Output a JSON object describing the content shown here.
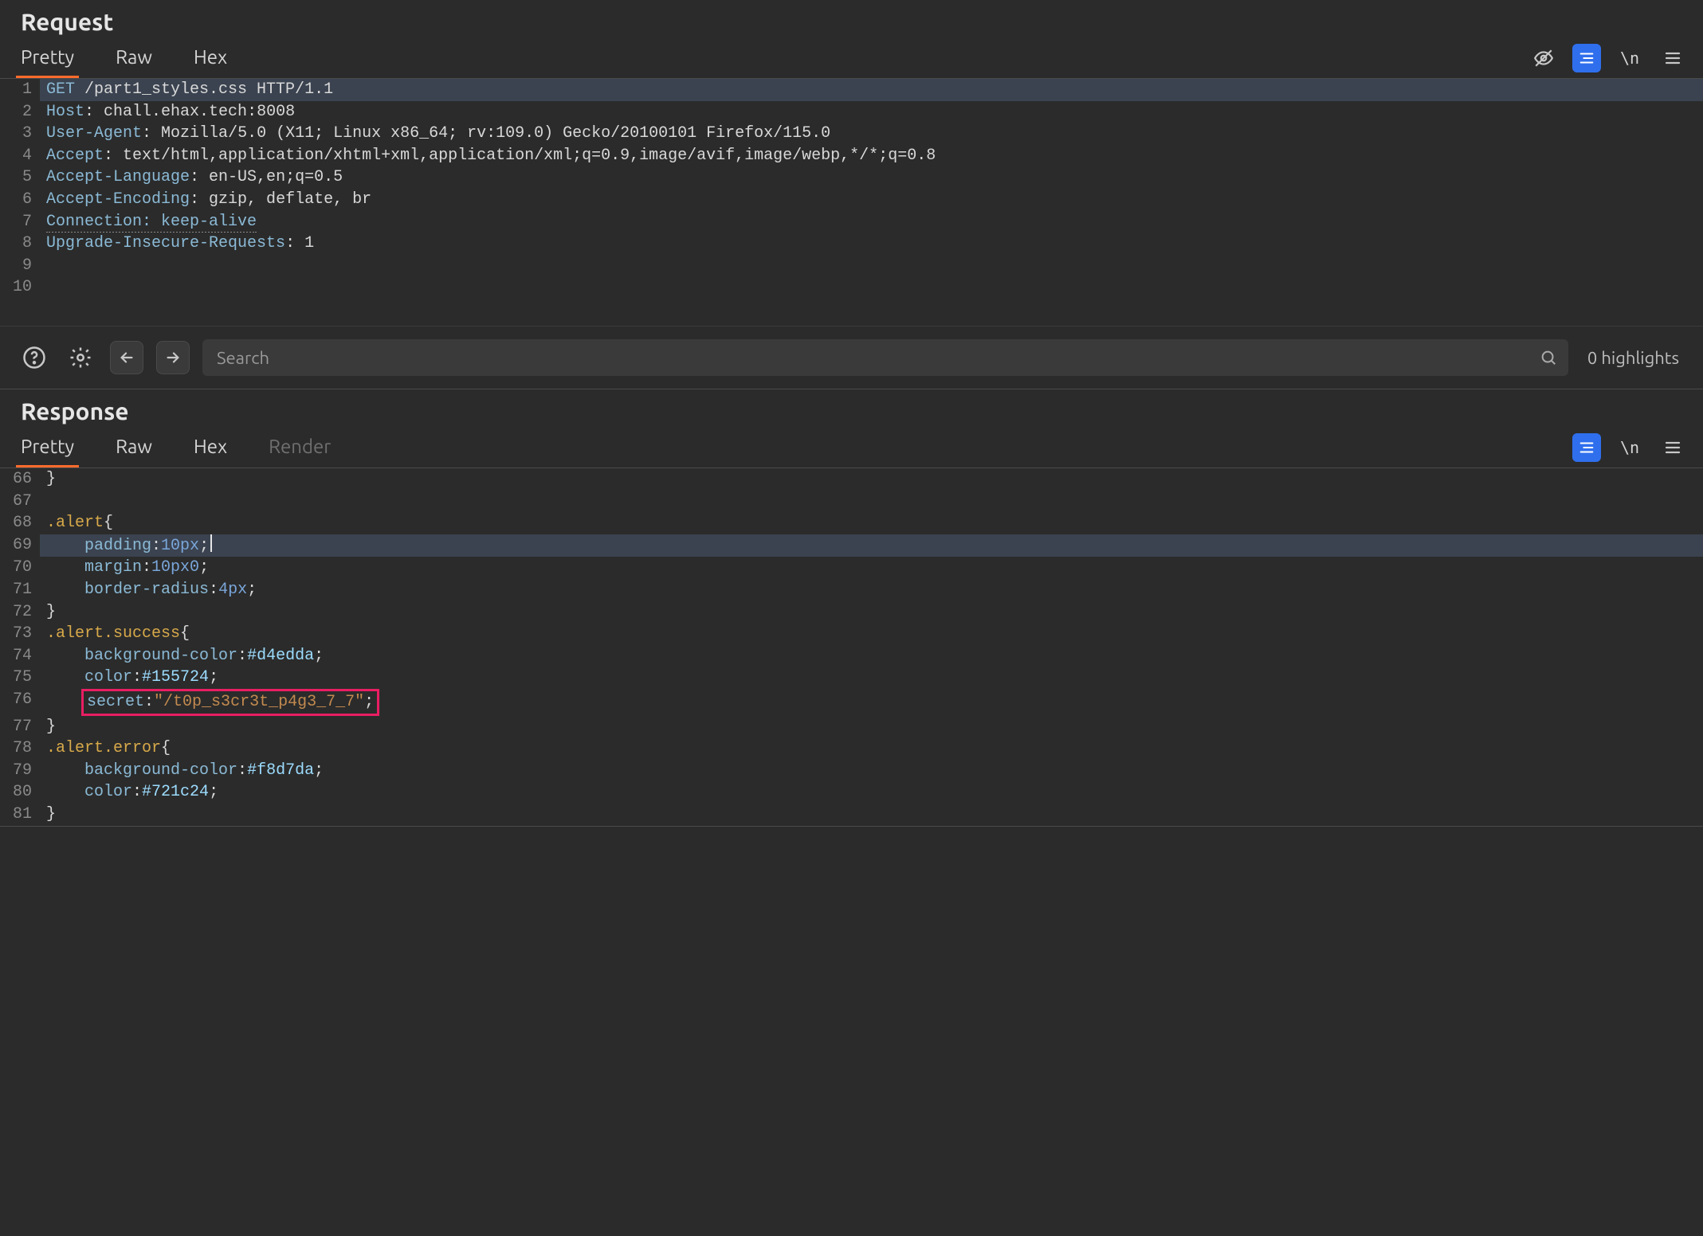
{
  "request": {
    "title": "Request",
    "tabs": {
      "pretty": "Pretty",
      "raw": "Raw",
      "hex": "Hex",
      "active": "pretty"
    },
    "lines": [
      {
        "n": 1,
        "type": "req-line",
        "method": "GET",
        "path": "/part1_styles.css",
        "proto": "HTTP/1.1",
        "selected": true
      },
      {
        "n": 2,
        "type": "hdr",
        "name": "Host",
        "value": "chall.ehax.tech:8008"
      },
      {
        "n": 3,
        "type": "hdr",
        "name": "User-Agent",
        "value": "Mozilla/5.0 (X11; Linux x86_64; rv:109.0) Gecko/20100101 Firefox/115.0"
      },
      {
        "n": 4,
        "type": "hdr",
        "name": "Accept",
        "value": "text/html,application/xhtml+xml,application/xml;q=0.9,image/avif,image/webp,*/*;q=0.8"
      },
      {
        "n": 5,
        "type": "hdr",
        "name": "Accept-Language",
        "value": "en-US,en;q=0.5"
      },
      {
        "n": 6,
        "type": "hdr",
        "name": "Accept-Encoding",
        "value": "gzip, deflate, br"
      },
      {
        "n": 7,
        "type": "hdr",
        "name": "Connection",
        "value": "keep-alive",
        "dotted": true
      },
      {
        "n": 8,
        "type": "hdr",
        "name": "Upgrade-Insecure-Requests",
        "value": "1"
      },
      {
        "n": 9,
        "type": "blank"
      },
      {
        "n": 10,
        "type": "blank"
      }
    ]
  },
  "search": {
    "placeholder": "Search",
    "highlights": "0 highlights"
  },
  "response": {
    "title": "Response",
    "tabs": {
      "pretty": "Pretty",
      "raw": "Raw",
      "hex": "Hex",
      "render": "Render",
      "active": "pretty"
    },
    "lines": [
      {
        "n": 66,
        "type": "css",
        "text": "}",
        "tokens": [
          [
            "pun",
            "}"
          ]
        ]
      },
      {
        "n": 67,
        "type": "css",
        "text": "",
        "tokens": []
      },
      {
        "n": 68,
        "type": "css",
        "tokens": [
          [
            "sel",
            ".alert"
          ],
          [
            "pun",
            "{"
          ]
        ]
      },
      {
        "n": 69,
        "type": "css",
        "indent": 1,
        "tokens": [
          [
            "prop",
            "padding"
          ],
          [
            "pun",
            ":"
          ],
          [
            "num",
            "10px"
          ],
          [
            "pun",
            ";"
          ]
        ],
        "selected": true,
        "caret": true
      },
      {
        "n": 70,
        "type": "css",
        "indent": 1,
        "tokens": [
          [
            "prop",
            "margin"
          ],
          [
            "pun",
            ":"
          ],
          [
            "num",
            "10px0"
          ],
          [
            "pun",
            ";"
          ]
        ]
      },
      {
        "n": 71,
        "type": "css",
        "indent": 1,
        "tokens": [
          [
            "prop",
            "border-radius"
          ],
          [
            "pun",
            ":"
          ],
          [
            "num",
            "4px"
          ],
          [
            "pun",
            ";"
          ]
        ]
      },
      {
        "n": 72,
        "type": "css",
        "tokens": [
          [
            "pun",
            "}"
          ]
        ]
      },
      {
        "n": 73,
        "type": "css",
        "tokens": [
          [
            "sel",
            ".alert.success"
          ],
          [
            "pun",
            "{"
          ]
        ]
      },
      {
        "n": 74,
        "type": "css",
        "indent": 1,
        "tokens": [
          [
            "prop",
            "background-color"
          ],
          [
            "pun",
            ":"
          ],
          [
            "hex",
            "#d4edda"
          ],
          [
            "pun",
            ";"
          ]
        ]
      },
      {
        "n": 75,
        "type": "css",
        "indent": 1,
        "tokens": [
          [
            "prop",
            "color"
          ],
          [
            "pun",
            ":"
          ],
          [
            "hex",
            "#155724"
          ],
          [
            "pun",
            ";"
          ]
        ]
      },
      {
        "n": 76,
        "type": "css",
        "indent": 1,
        "annot": true,
        "tokens": [
          [
            "prop",
            "secret"
          ],
          [
            "pun",
            ":"
          ],
          [
            "str",
            "\"/t0p_s3cr3t_p4g3_7_7\""
          ],
          [
            "pun",
            ";"
          ]
        ]
      },
      {
        "n": 77,
        "type": "css",
        "tokens": [
          [
            "pun",
            "}"
          ]
        ]
      },
      {
        "n": 78,
        "type": "css",
        "tokens": [
          [
            "sel",
            ".alert.error"
          ],
          [
            "pun",
            "{"
          ]
        ]
      },
      {
        "n": 79,
        "type": "css",
        "indent": 1,
        "tokens": [
          [
            "prop",
            "background-color"
          ],
          [
            "pun",
            ":"
          ],
          [
            "hex",
            "#f8d7da"
          ],
          [
            "pun",
            ";"
          ]
        ]
      },
      {
        "n": 80,
        "type": "css",
        "indent": 1,
        "tokens": [
          [
            "prop",
            "color"
          ],
          [
            "pun",
            ":"
          ],
          [
            "hex",
            "#721c24"
          ],
          [
            "pun",
            ";"
          ]
        ]
      },
      {
        "n": 81,
        "type": "css",
        "tokens": [
          [
            "pun",
            "}"
          ]
        ]
      }
    ]
  },
  "icons": {
    "eye_off": "eye-off-icon",
    "beautify": "beautify-icon",
    "newline": "\\n",
    "menu": "menu-icon",
    "help": "?",
    "settings": "gear-icon",
    "prev": "arrow-left-icon",
    "next": "arrow-right-icon",
    "search": "search-icon"
  }
}
